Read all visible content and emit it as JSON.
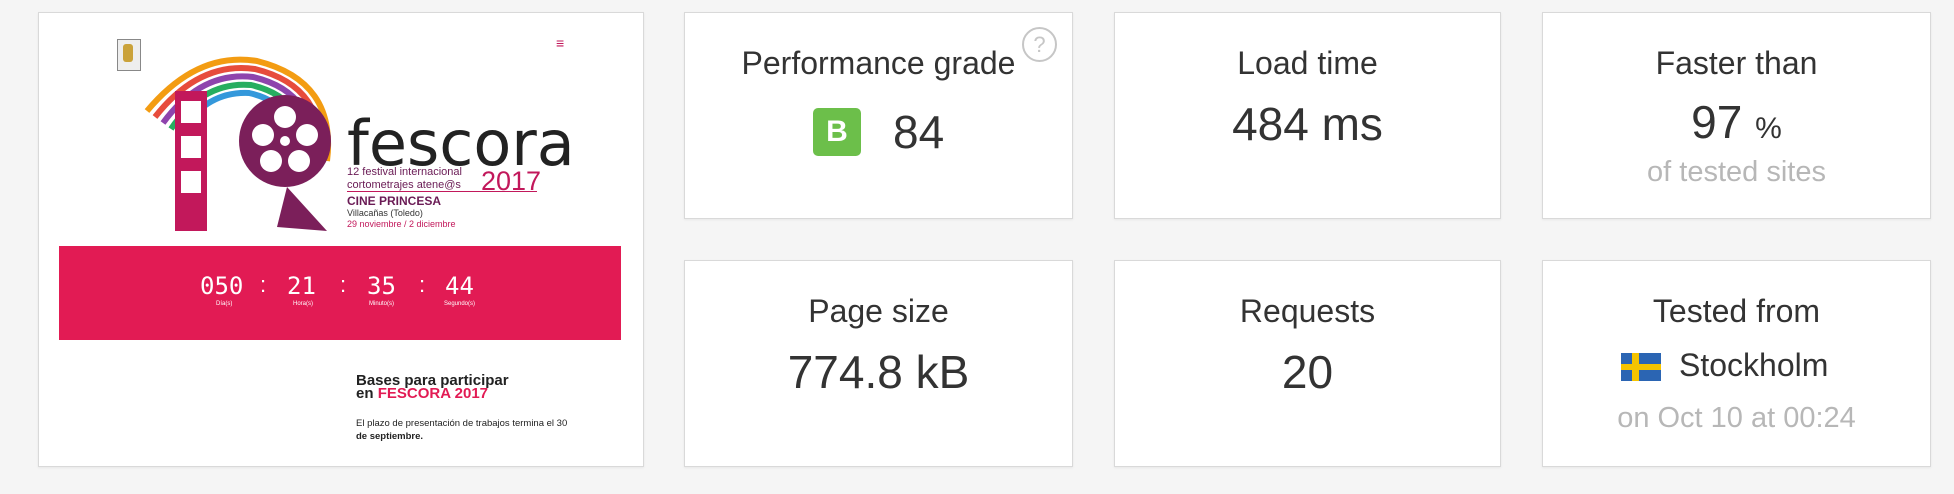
{
  "screenshot": {
    "menu_glyph": "≡",
    "title": "fescora",
    "fest_line1": "12 festival internacional",
    "fest_line2": "cortometrajes atene@s",
    "year": "2017",
    "cine": "CINE PRINCESA",
    "location": "Villacañas (Toledo)",
    "dates": "29 noviembre / 2 diciembre",
    "countdown": [
      {
        "value": "050",
        "label": "Día(s)"
      },
      {
        "value": "21",
        "label": "Hora(s)"
      },
      {
        "value": "35",
        "label": "Minuto(s)"
      },
      {
        "value": "44",
        "label": "Segundo(s)"
      }
    ],
    "separator": ":",
    "bases_title_1": "Bases para participar",
    "bases_title_2_prefix": "en ",
    "bases_title_2_highlight": "FESCORA 2017",
    "bases_text_1": "El plazo de presentación de trabajos termina el 30",
    "bases_text_2": "de septiembre."
  },
  "metrics": {
    "performance": {
      "label": "Performance grade",
      "grade": "B",
      "score": "84",
      "grade_color": "#6cbf4a",
      "help_glyph": "?"
    },
    "load_time": {
      "label": "Load time",
      "value": "484 ms"
    },
    "faster_than": {
      "label": "Faster than",
      "value": "97",
      "unit": "%",
      "sub": "of tested sites"
    },
    "page_size": {
      "label": "Page size",
      "value": "774.8 kB"
    },
    "requests": {
      "label": "Requests",
      "value": "20"
    },
    "tested_from": {
      "label": "Tested from",
      "city": "Stockholm",
      "when": "on Oct 10 at 00:24",
      "flag": "sweden-flag-icon"
    }
  }
}
